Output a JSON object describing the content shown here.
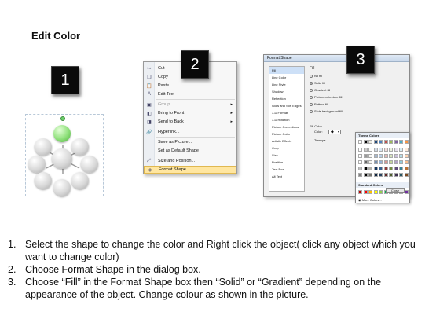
{
  "title": "Edit Color",
  "steps": [
    {
      "number": "1"
    },
    {
      "number": "2"
    },
    {
      "number": "3"
    }
  ],
  "context_menu": {
    "items": [
      {
        "icon": "cut-icon",
        "glyph": "✂",
        "label": "Cut",
        "disabled": false
      },
      {
        "icon": "copy-icon",
        "glyph": "❐",
        "label": "Copy",
        "disabled": false
      },
      {
        "icon": "paste-icon",
        "glyph": "📋",
        "label": "Paste",
        "disabled": false
      },
      {
        "icon": "edit-text-icon",
        "glyph": "A",
        "label": "Edit Text",
        "disabled": false
      },
      {
        "icon": "group-icon",
        "glyph": "▣",
        "label": "Group",
        "disabled": true,
        "submenu": true
      },
      {
        "icon": "bring-to-front-icon",
        "glyph": "◧",
        "label": "Bring to Front",
        "disabled": false,
        "submenu": true
      },
      {
        "icon": "send-to-back-icon",
        "glyph": "◨",
        "label": "Send to Back",
        "disabled": false,
        "submenu": true
      },
      {
        "icon": "hyperlink-icon",
        "glyph": "🔗",
        "label": "Hyperlink...",
        "disabled": false
      },
      {
        "icon": "save-as-picture-icon",
        "glyph": "",
        "label": "Save as Picture...",
        "disabled": false
      },
      {
        "icon": "default-shape-icon",
        "glyph": "",
        "label": "Set as Default Shape",
        "disabled": false
      },
      {
        "icon": "size-position-icon",
        "glyph": "⤢",
        "label": "Size and Position...",
        "disabled": false
      },
      {
        "icon": "format-shape-icon",
        "glyph": "◈",
        "label": "Format Shape...",
        "disabled": false,
        "highlighted": true
      }
    ]
  },
  "dialog": {
    "title": "Format Shape",
    "nav": [
      "Fill",
      "Line Color",
      "Line Style",
      "Shadow",
      "Reflection",
      "Glow and Soft Edges",
      "3-D Format",
      "3-D Rotation",
      "Picture Corrections",
      "Picture Color",
      "Artistic Effects",
      "Crop",
      "Size",
      "Position",
      "Text Box",
      "Alt Text"
    ],
    "section": "Fill",
    "options": [
      "No fill",
      "Solid fill",
      "Gradient fill",
      "Picture or texture fill",
      "Pattern fill",
      "Slide background fill"
    ],
    "selected_option": "Solid fill",
    "fill_color_label": "Fill Color",
    "color_label": "Color:",
    "transparency_label": "Transpa",
    "theme_colors_label": "Theme Colors",
    "standard_colors_label": "Standard Colors",
    "more_colors_label": "More Colors...",
    "close_label": "Close",
    "theme_colors": [
      "#ffffff",
      "#000000",
      "#eeece1",
      "#1f497d",
      "#4f81bd",
      "#c0504d",
      "#9bbb59",
      "#8064a2",
      "#4bacc6",
      "#f79646"
    ],
    "standard_colors": [
      "#c00000",
      "#ff0000",
      "#ffc000",
      "#ffff00",
      "#92d050",
      "#00b050",
      "#00b0f0",
      "#0070c0",
      "#002060",
      "#7030a0"
    ]
  },
  "instructions": [
    {
      "num": "1.",
      "text": "Select the shape to change the color and Right click the object( click any object which you want to change color)"
    },
    {
      "num": "2.",
      "text": "Choose Format Shape in the dialog box."
    },
    {
      "num": "3.",
      "text": "Choose “Fill” in the Format Shape box then “Solid” or “Gradient” depending on the appearance of the object. Change colour as shown in the picture."
    }
  ]
}
